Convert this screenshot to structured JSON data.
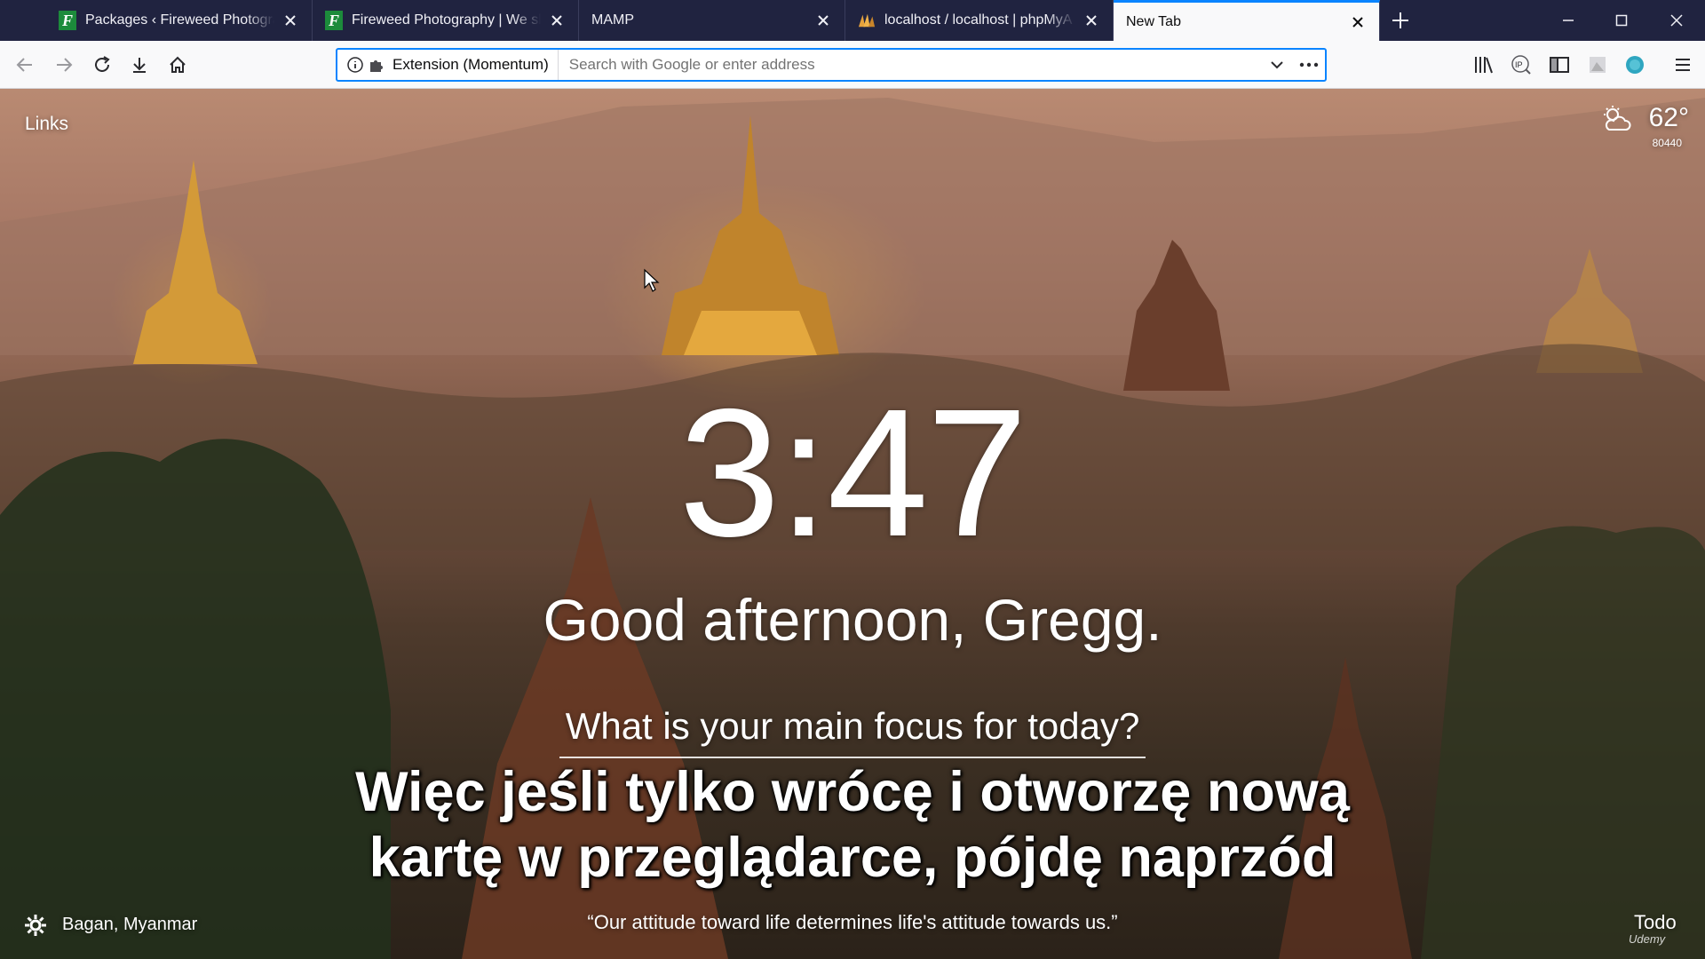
{
  "tabs": [
    {
      "title": "Packages ‹ Fireweed Photograp",
      "favicon": "fireweed-icon"
    },
    {
      "title": "Fireweed Photography | We sh",
      "favicon": "fireweed-icon"
    },
    {
      "title": "MAMP",
      "favicon": ""
    },
    {
      "title": "localhost / localhost | phpMyA",
      "favicon": "phpmyadmin-icon"
    },
    {
      "title": "New Tab",
      "favicon": ""
    }
  ],
  "toolbar": {
    "identity_label": "Extension (Momentum)",
    "url_placeholder": "Search with Google or enter address",
    "url_value": ""
  },
  "momentum": {
    "links_label": "Links",
    "weather_temp": "62°",
    "weather_location": "80440",
    "clock": "3:47",
    "greeting": "Good afternoon, Gregg.",
    "focus_question": "What is your main focus for today?",
    "photo_location": "Bagan, Myanmar",
    "quote": "“Our attitude toward life determines life's attitude towards us.”",
    "todo_label": "Todo",
    "watermark": "Udemy"
  },
  "subtitles": {
    "line1": "Więc jeśli tylko wrócę i otworzę nową",
    "line2": "kartę w przeglądarce, pójdę naprzód"
  },
  "colors": {
    "accent": "#0a84ff",
    "tabstrip": "#202340",
    "navbar": "#f9f9fa"
  }
}
